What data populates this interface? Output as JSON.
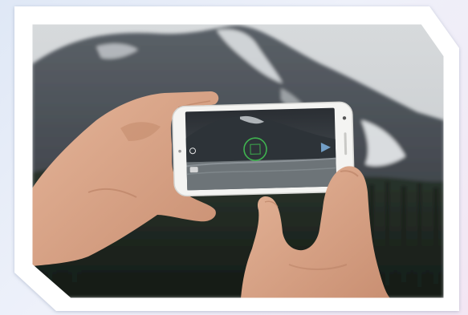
{
  "image": {
    "subject": "photo-of-hands-holding-smartphone-camera",
    "colors": {
      "page_background_top": "#dfe8f6",
      "page_background_bottom": "#f3e6f3",
      "frame_white": "#ffffff",
      "sky": "#c9ccce",
      "mountain": "#4a4f55",
      "snow": "#e7eaec",
      "forest": "#1f2a22",
      "skin": "#d8a588",
      "phone_body": "#f4f4f2",
      "focus_ring": "#3fb34f"
    }
  },
  "phone_screen": {
    "focus_indicator": "circle",
    "shutter_icon": "camera-icon",
    "switch_icon": "camera-switch-icon",
    "mode_icon": "video-mode-icon"
  }
}
